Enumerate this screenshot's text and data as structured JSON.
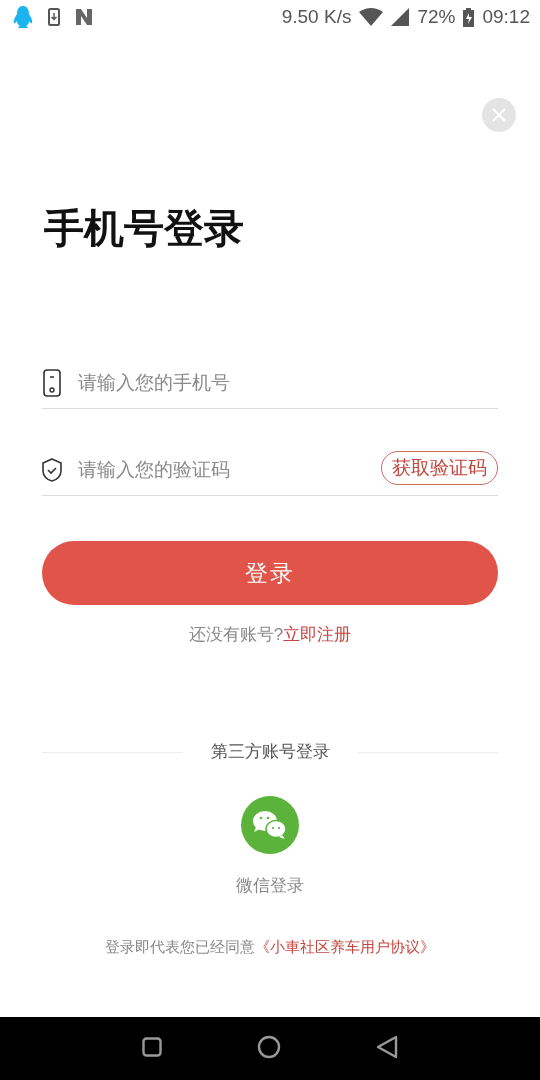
{
  "status_bar": {
    "network_speed": "9.50 K/s",
    "battery": "72%",
    "time": "09:12"
  },
  "title": "手机号登录",
  "fields": [
    {
      "kind": "phone",
      "placeholder": "请输入您的手机号"
    },
    {
      "kind": "code",
      "placeholder": "请输入您的验证码",
      "action": "获取验证码"
    }
  ],
  "login_button": "登录",
  "register_prompt": {
    "text": "还没有账号?",
    "link": "立即注册"
  },
  "third_party": {
    "heading": "第三方账号登录",
    "options": [
      {
        "kind": "wechat",
        "label": "微信登录"
      }
    ]
  },
  "agreement": {
    "text": "登录即代表您已经同意",
    "link": "《小車社区养车用户协议》"
  }
}
